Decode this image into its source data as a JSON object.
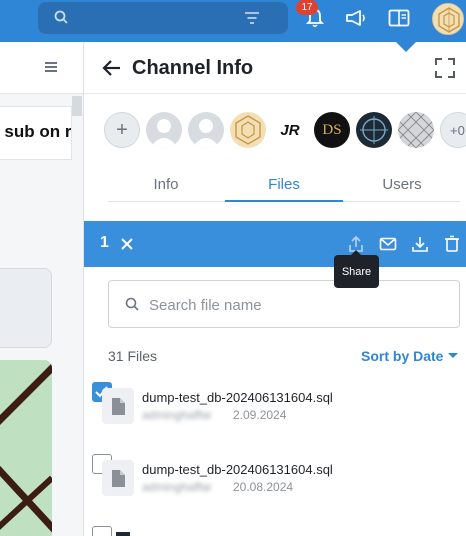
{
  "topbar": {
    "search_placeholder": "",
    "notification_count": "17",
    "colors": {
      "bar": "#2f86d6",
      "badge": "#e0412f"
    }
  },
  "left_pane": {
    "card_text": "t sub on r"
  },
  "panel": {
    "title": "Channel Info",
    "members": {
      "more_label": "+0",
      "jr_label": "JR",
      "ds_label": "DS"
    },
    "tabs": [
      {
        "label": "Info",
        "active": false
      },
      {
        "label": "Files",
        "active": true
      },
      {
        "label": "Users",
        "active": false
      }
    ],
    "selection_bar": {
      "selected_count": "1",
      "tooltip": "Share"
    },
    "file_search": {
      "placeholder": "Search file name",
      "value": ""
    },
    "files_count": "31 Files",
    "sort_label": "Sort by Date",
    "files": [
      {
        "name": "dump-test_db-202406131604.sql",
        "user": "adminghaffar",
        "date": "2.09.2024",
        "checked": true
      },
      {
        "name": "dump-test_db-202406131604.sql",
        "user": "adminghaffar",
        "date": "20.08.2024",
        "checked": false
      }
    ]
  }
}
